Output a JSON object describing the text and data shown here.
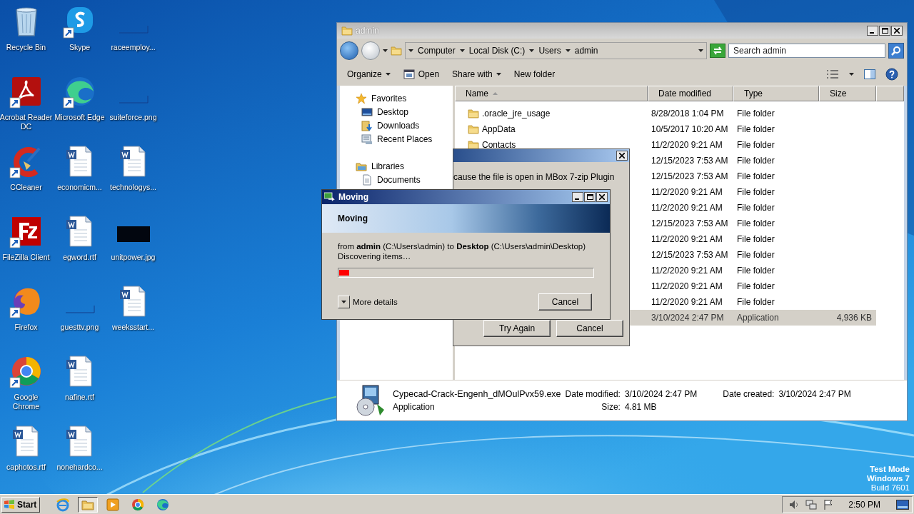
{
  "desktop_icons": [
    {
      "label": "Recycle Bin",
      "kind": "trash",
      "shortcut": false
    },
    {
      "label": "Acrobat Reader DC",
      "kind": "pdf",
      "shortcut": true
    },
    {
      "label": "CCleaner",
      "kind": "cleaner",
      "shortcut": true
    },
    {
      "label": "FileZilla Client",
      "kind": "tile",
      "shortcut": true
    },
    {
      "label": "Firefox",
      "kind": "fox",
      "shortcut": true
    },
    {
      "label": "Google Chrome",
      "kind": "ring",
      "shortcut": true
    },
    {
      "label": "caphotos.rtf",
      "kind": "doc",
      "shortcut": false
    },
    {
      "label": "Skype",
      "kind": "chat",
      "shortcut": true
    },
    {
      "label": "Microsoft Edge",
      "kind": "wave",
      "shortcut": true
    },
    {
      "label": "economicm...",
      "kind": "doc",
      "shortcut": false
    },
    {
      "label": "egword.rtf",
      "kind": "doc",
      "shortcut": false
    },
    {
      "label": "guesttv.png",
      "kind": "blank",
      "shortcut": false
    },
    {
      "label": "nafine.rtf",
      "kind": "doc",
      "shortcut": false
    },
    {
      "label": "nonehardco...",
      "kind": "doc",
      "shortcut": false
    },
    {
      "label": "raceemploy...",
      "kind": "blank",
      "shortcut": false
    },
    {
      "label": "suiteforce.png",
      "kind": "blank",
      "shortcut": false
    },
    {
      "label": "technologys...",
      "kind": "doc",
      "shortcut": false
    },
    {
      "label": "unitpower.jpg",
      "kind": "dark",
      "shortcut": false
    },
    {
      "label": "weeksstart...",
      "kind": "doc",
      "shortcut": false
    }
  ],
  "system_notice": [
    "Test Mode",
    "Windows 7",
    "Build 7601"
  ],
  "explorer": {
    "title": "admin",
    "breadcrumb": [
      "Computer",
      "Local Disk (C:)",
      "Users",
      "admin"
    ],
    "search": {
      "placeholder": "Search admin"
    },
    "toolbar": [
      {
        "label": "Organize",
        "dropdown": true,
        "kind": "plain"
      },
      {
        "label": "Open",
        "dropdown": false,
        "kind": "open"
      },
      {
        "label": "Share with",
        "dropdown": true,
        "kind": "plain"
      },
      {
        "label": "New folder",
        "dropdown": false,
        "kind": "plain"
      }
    ],
    "nav": [
      {
        "label": "Favorites",
        "kind": "star",
        "children": [
          {
            "label": "Desktop",
            "kind": "desktop"
          },
          {
            "label": "Downloads",
            "kind": "downloads"
          },
          {
            "label": "Recent Places",
            "kind": "recent"
          }
        ]
      },
      {
        "label": "Libraries",
        "kind": "library",
        "children": [
          {
            "label": "Documents",
            "kind": "document"
          }
        ]
      }
    ],
    "columns": [
      "Name",
      "Date modified",
      "Type",
      "Size"
    ],
    "rows": [
      {
        "name": ".oracle_jre_usage",
        "date": "8/28/2018 1:04 PM",
        "type": "File folder",
        "selected": false
      },
      {
        "name": "AppData",
        "date": "10/5/2017 10:20 AM",
        "type": "File folder",
        "selected": false
      },
      {
        "name": "Contacts",
        "date": "11/2/2020 9:21 AM",
        "type": "File folder",
        "selected": false
      },
      {
        "date": "12/15/2023 7:53 AM",
        "type": "File folder",
        "selected": false
      },
      {
        "date": "12/15/2023 7:53 AM",
        "type": "File folder",
        "selected": false
      },
      {
        "date": "11/2/2020 9:21 AM",
        "type": "File folder",
        "selected": false
      },
      {
        "date": "11/2/2020 9:21 AM",
        "type": "File folder",
        "selected": false
      },
      {
        "date": "12/15/2023 7:53 AM",
        "type": "File folder",
        "selected": false
      },
      {
        "date": "11/2/2020 9:21 AM",
        "type": "File folder",
        "selected": false
      },
      {
        "date": "12/15/2023 7:53 AM",
        "type": "File folder",
        "selected": false
      },
      {
        "date": "11/2/2020 9:21 AM",
        "type": "File folder",
        "selected": false
      },
      {
        "date": "11/2/2020 9:21 AM",
        "type": "File folder",
        "selected": false
      },
      {
        "date": "11/2/2020 9:21 AM",
        "type": "File folder",
        "selected": false
      },
      {
        "date": "3/10/2024 2:47 PM",
        "type": "Application",
        "size": "4,936 KB",
        "selected": true
      }
    ],
    "details": {
      "file_name": "Cypecad-Crack-Engenh_dMOulPvx59.exe",
      "file_type": "Application",
      "date_modified_label": "Date modified:",
      "date_modified": "3/10/2024 2:47 PM",
      "size_label": "Size:",
      "size": "4.81 MB",
      "date_created_label": "Date created:",
      "date_created": "3/10/2024 2:47 PM"
    }
  },
  "error_dialog": {
    "message": "cause the file is open in MBox 7-zip Plugin",
    "buttons": [
      "Try Again",
      "Cancel"
    ]
  },
  "moving_dialog": {
    "title": "Moving",
    "heading": "Moving",
    "route": "from **admin** (C:\\Users\\admin) to **Desktop** (C:\\Users\\admin\\Desktop)",
    "status": "Discovering items…",
    "progress": {
      "level": 0.04
    },
    "more_details": "More details",
    "cancel": "Cancel"
  },
  "taskbar": {
    "start": "Start",
    "apps": [
      {
        "kind": "ie",
        "selected": false
      },
      {
        "kind": "folder",
        "selected": true
      },
      {
        "kind": "media",
        "selected": false
      },
      {
        "kind": "ring",
        "selected": false
      },
      {
        "kind": "wave",
        "selected": false
      }
    ],
    "clock": "2:50 PM"
  }
}
